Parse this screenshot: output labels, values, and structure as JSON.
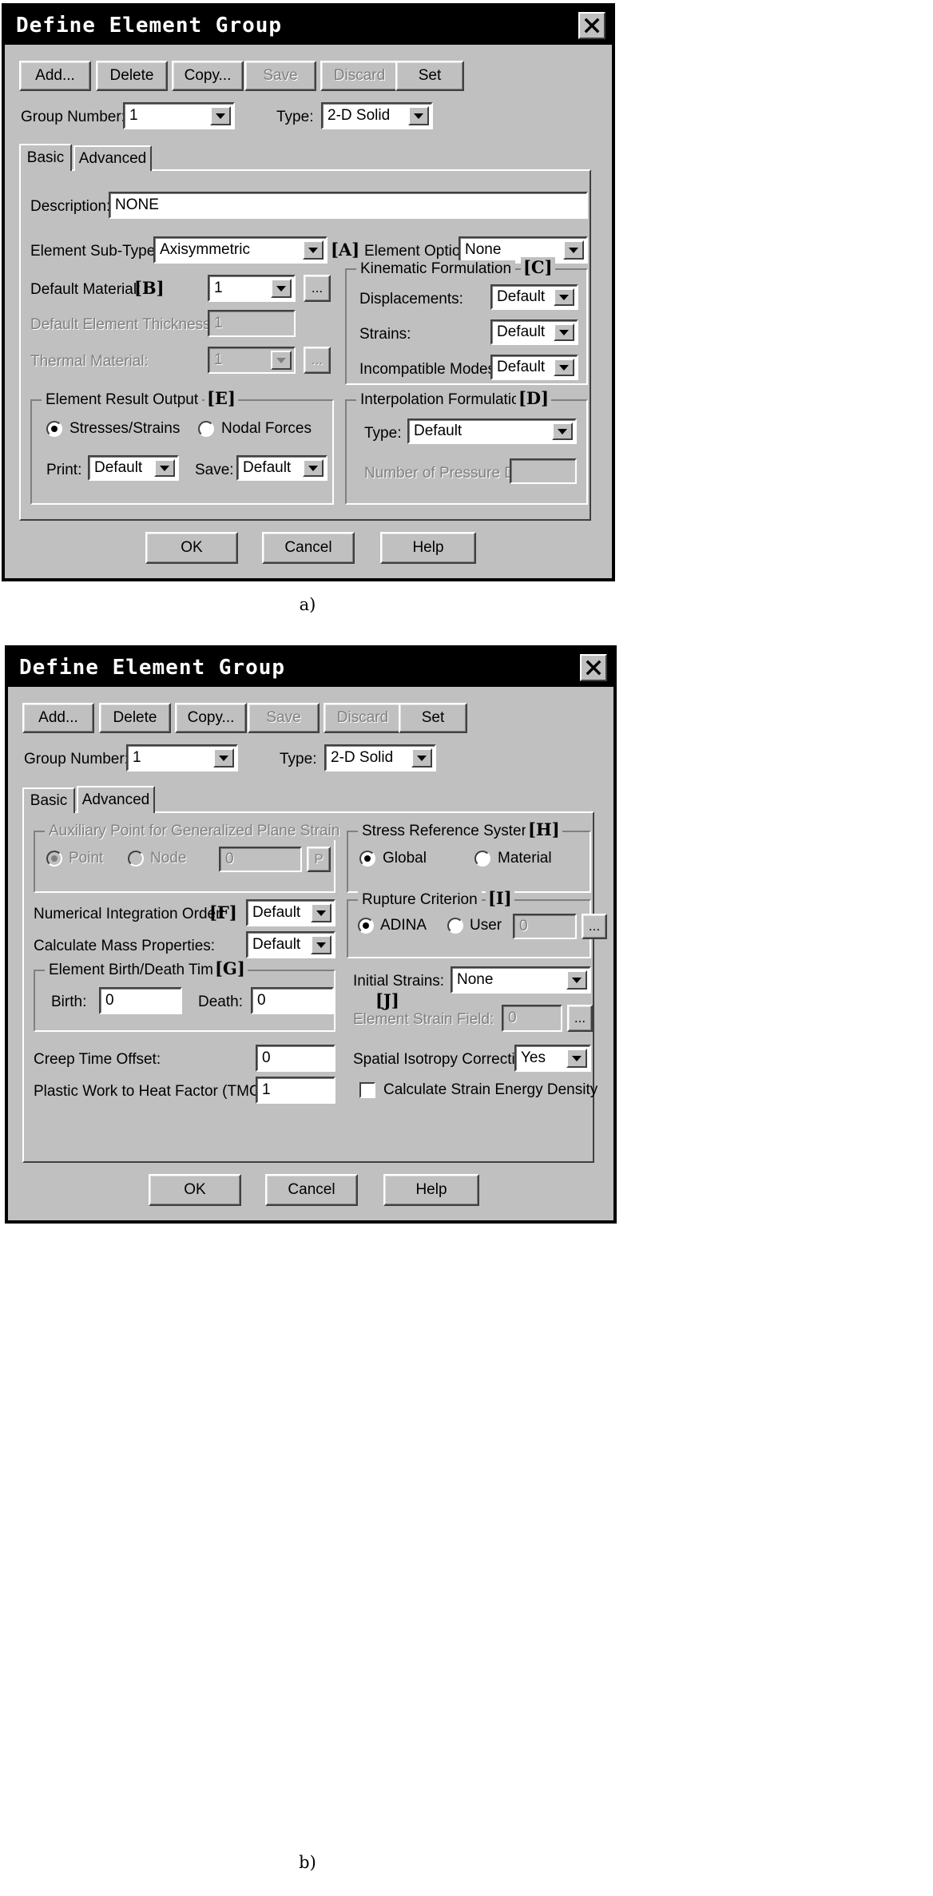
{
  "figure": {
    "caption_a": "a)",
    "caption_b": "b)"
  },
  "dialog_a": {
    "title": "Define Element Group",
    "close_icon": "close-icon",
    "toolbar": [
      {
        "label": "Add...",
        "enabled": true
      },
      {
        "label": "Delete",
        "enabled": true
      },
      {
        "label": "Copy...",
        "enabled": true
      },
      {
        "label": "Save",
        "enabled": false
      },
      {
        "label": "Discard",
        "enabled": false
      },
      {
        "label": "Set",
        "enabled": true
      }
    ],
    "group_number": {
      "label": "Group Number:",
      "value": "1"
    },
    "type": {
      "label": "Type:",
      "value": "2-D Solid"
    },
    "tabs": [
      {
        "label": "Basic",
        "active": true
      },
      {
        "label": "Advanced",
        "active": false
      }
    ],
    "description": {
      "label": "Description:",
      "value": "NONE"
    },
    "element_sub_type": {
      "label": "Element Sub-Type:",
      "value": "Axisymmetric",
      "marker": "[A]"
    },
    "element_option": {
      "label": "Element Option:",
      "value": "None"
    },
    "default_material": {
      "label": "Default Material:",
      "value": "1",
      "marker": "[B]",
      "browse": "..."
    },
    "default_element_thickness": {
      "label": "Default Element Thickness:",
      "value": "1"
    },
    "thermal_material": {
      "label": "Thermal Material:",
      "value": "1",
      "browse": "..."
    },
    "kinematic_formulation": {
      "caption": "Kinematic Formulation",
      "marker": "[C]",
      "rows": [
        {
          "label": "Displacements:",
          "value": "Default"
        },
        {
          "label": "Strains:",
          "value": "Default"
        },
        {
          "label": "Incompatible Modes:",
          "value": "Default"
        }
      ]
    },
    "element_result_output": {
      "caption": "Element Result Output",
      "marker": "[E]",
      "radios": [
        {
          "label": "Stresses/Strains",
          "selected": true
        },
        {
          "label": "Nodal Forces",
          "selected": false
        }
      ],
      "print": {
        "label": "Print:",
        "value": "Default"
      },
      "save": {
        "label": "Save:",
        "value": "Default"
      }
    },
    "interpolation_formulation": {
      "caption": "Interpolation Formulation",
      "marker": "[D]",
      "type": {
        "label": "Type:",
        "value": "Default"
      },
      "pressure_dof": {
        "label": "Number of Pressure DOF:",
        "value": ""
      }
    },
    "footer": [
      {
        "label": "OK"
      },
      {
        "label": "Cancel"
      },
      {
        "label": "Help"
      }
    ]
  },
  "dialog_b": {
    "title": "Define Element Group",
    "close_icon": "close-icon",
    "toolbar": [
      {
        "label": "Add...",
        "enabled": true
      },
      {
        "label": "Delete",
        "enabled": true
      },
      {
        "label": "Copy...",
        "enabled": true
      },
      {
        "label": "Save",
        "enabled": false
      },
      {
        "label": "Discard",
        "enabled": false
      },
      {
        "label": "Set",
        "enabled": true
      }
    ],
    "group_number": {
      "label": "Group Number:",
      "value": "1"
    },
    "type": {
      "label": "Type:",
      "value": "2-D Solid"
    },
    "tabs": [
      {
        "label": "Basic",
        "active": false
      },
      {
        "label": "Advanced",
        "active": true
      }
    ],
    "auxiliary_point": {
      "caption": "Auxiliary Point for Generalized Plane Strain",
      "radios": [
        {
          "label": "Point",
          "selected": true
        },
        {
          "label": "Node",
          "selected": false
        }
      ],
      "value": "0",
      "pick_button": "P"
    },
    "stress_reference_system": {
      "caption": "Stress Reference System",
      "marker": "[H]",
      "radios": [
        {
          "label": "Global",
          "selected": true
        },
        {
          "label": "Material",
          "selected": false
        }
      ]
    },
    "numerical_integration_order": {
      "label": "Numerical Integration Order:",
      "marker": "[F]",
      "value": "Default"
    },
    "calculate_mass_properties": {
      "label": "Calculate Mass Properties:",
      "value": "Default"
    },
    "rupture_criterion": {
      "caption": "Rupture Criterion",
      "marker": "[I]",
      "radios": [
        {
          "label": "ADINA",
          "selected": true
        },
        {
          "label": "User",
          "selected": false
        }
      ],
      "value": "0",
      "browse": "..."
    },
    "element_birth_death": {
      "caption": "Element Birth/Death Time",
      "marker": "[G]",
      "birth": {
        "label": "Birth:",
        "value": "0"
      },
      "death": {
        "label": "Death:",
        "value": "0"
      }
    },
    "initial_strains": {
      "label": "Initial Strains:",
      "marker": "[J]",
      "value": "None"
    },
    "element_strain_field": {
      "label": "Element Strain Field:",
      "value": "0",
      "browse": "..."
    },
    "creep_time_offset": {
      "label": "Creep Time Offset:",
      "value": "0"
    },
    "plastic_work": {
      "label": "Plastic Work to Heat Factor (TMC):",
      "value": "1"
    },
    "spatial_isotropy": {
      "label": "Spatial Isotropy Correction:",
      "value": "Yes"
    },
    "strain_energy_density": {
      "label": "Calculate Strain Energy Density",
      "checked": false
    },
    "footer": [
      {
        "label": "OK"
      },
      {
        "label": "Cancel"
      },
      {
        "label": "Help"
      }
    ]
  }
}
